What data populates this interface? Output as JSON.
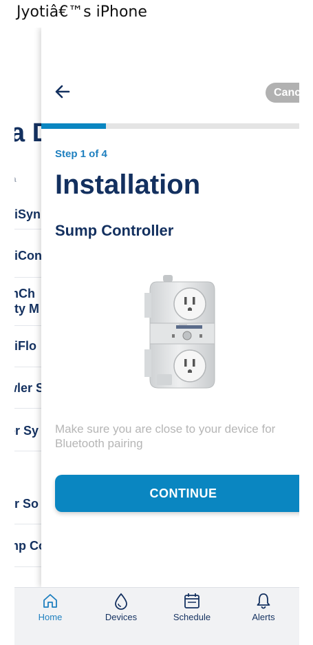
{
  "window": {
    "title": "Jyotiâ€™s iPhone"
  },
  "background": {
    "heading": "a D",
    "sub": "a",
    "rows": [
      "lliSyn",
      "lliCon",
      "mCh",
      "lity M",
      "lliFlo",
      "wler S",
      "or Sy",
      "er So",
      "mp Co"
    ]
  },
  "sheet": {
    "cancel_label": "Cancel",
    "progress": {
      "current_step": 1,
      "total_steps": 4,
      "fraction": 0.25
    },
    "step_label": "Step 1 of 4",
    "title": "Installation",
    "device_name": "Sump Controller",
    "hint": "Make sure you are close to your device for Bluetooth pairing",
    "continue_label": "CONTINUE"
  },
  "tabbar": {
    "tabs": [
      {
        "label": "Home",
        "icon": "home-icon",
        "active": true
      },
      {
        "label": "Devices",
        "icon": "drop-icon",
        "active": false
      },
      {
        "label": "Schedule",
        "icon": "calendar-icon",
        "active": false
      },
      {
        "label": "Alerts",
        "icon": "bell-icon",
        "active": false
      }
    ]
  },
  "colors": {
    "primary": "#0a86c1",
    "navy": "#13305f",
    "step": "#1d7fbf",
    "cancel_bg": "#b1b1b1",
    "hint": "#b5b5b5"
  }
}
